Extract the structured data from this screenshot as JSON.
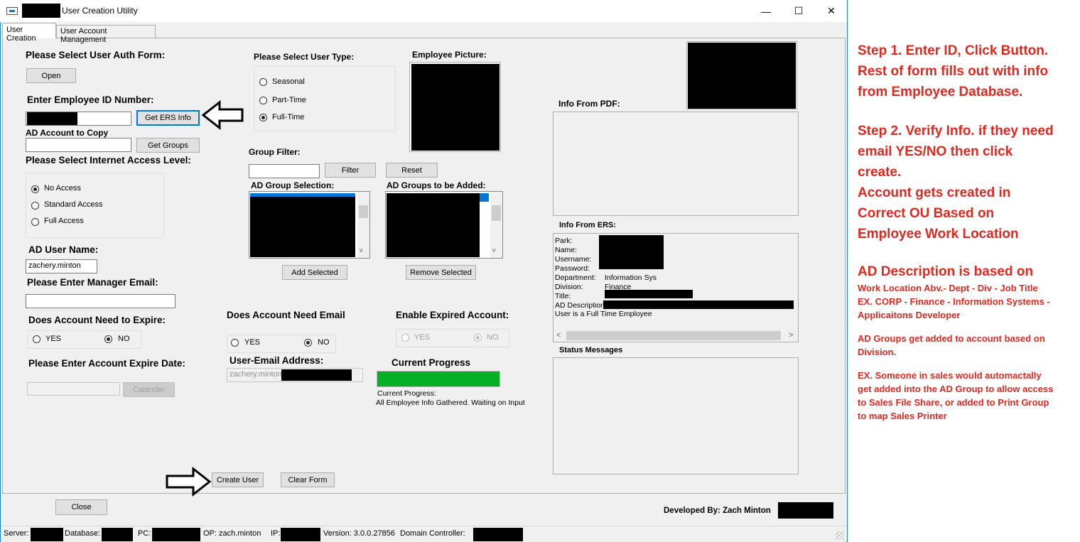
{
  "window": {
    "title": "User Creation Utility",
    "minimize": "—",
    "maximize": "☐",
    "close": "✕"
  },
  "tabs": [
    "User Creation",
    "User Account Management"
  ],
  "auth_form": {
    "label": "Please Select User Auth Form:",
    "open_button": "Open"
  },
  "employee_id": {
    "label": "Enter Employee ID Number:",
    "button": "Get ERS Info"
  },
  "ad_copy": {
    "label": "AD Account to Copy",
    "button": "Get Groups"
  },
  "internet_access": {
    "label": "Please Select Internet Access Level:",
    "options": [
      "No Access",
      "Standard Access",
      "Full Access"
    ],
    "selected": "No Access"
  },
  "ad_user_name": {
    "label": "AD User Name:",
    "value": "zachery.minton"
  },
  "manager_email": {
    "label": "Please Enter Manager Email:",
    "value": ""
  },
  "expire": {
    "label": "Does Account Need to Expire:",
    "yes": "YES",
    "no": "NO",
    "selected": "NO"
  },
  "expire_date": {
    "label": "Please Enter Account Expire Date:",
    "button": "Calander"
  },
  "user_type": {
    "label": "Please Select User Type:",
    "options": [
      "Seasonal",
      "Part-Time",
      "Full-Time"
    ],
    "selected": "Full-Time"
  },
  "group_filter": {
    "label": "Group Filter:",
    "filter_button": "Filter",
    "reset_button": "Reset"
  },
  "ad_group_selection": {
    "label": "AD Group Selection:",
    "button": "Add Selected"
  },
  "ad_groups_added": {
    "label": "AD Groups to be Added:",
    "button": "Remove Selected"
  },
  "employee_picture": {
    "label": "Employee Picture:"
  },
  "need_email": {
    "label": "Does Account Need Email",
    "yes": "YES",
    "no": "NO",
    "selected": "NO"
  },
  "user_email": {
    "label": "User-Email Address:",
    "value": "zachery.minton@"
  },
  "enable_expired": {
    "label": "Enable Expired Account:",
    "yes": "YES",
    "no": "NO",
    "selected": "NO"
  },
  "progress": {
    "label": "Current Progress",
    "value": 1.0,
    "color": "#06b025",
    "status_label": "Current Progress:",
    "status_text": "All Employee Info Gathered. Waiting on Input"
  },
  "info_pdf": {
    "label": "Info From PDF:"
  },
  "info_ers": {
    "label": "Info From ERS:",
    "rows": [
      {
        "key": "Park:",
        "value": ""
      },
      {
        "key": "Name:",
        "value": ""
      },
      {
        "key": "Username:",
        "value": ""
      },
      {
        "key": "Password:",
        "value": ""
      },
      {
        "key": "Department:",
        "value": "Information Sys"
      },
      {
        "key": "Division:",
        "value": "Finance"
      },
      {
        "key": "Title:",
        "value": ""
      },
      {
        "key": "AD Description:",
        "value": ""
      }
    ],
    "footer": "User is a Full Time Employee",
    "scroll_left": "<",
    "scroll_right": ">"
  },
  "status_messages": {
    "label": "Status Messages"
  },
  "actions": {
    "create": "Create User",
    "clear": "Clear Form",
    "close": "Close"
  },
  "developer": "Developed By: Zach Minton",
  "statusbar": {
    "server": "Server:",
    "database": "Database:",
    "pc": "PC:",
    "op": "OP: zach.minton",
    "ip": "IP:",
    "version": "Version: 3.0.0.27856",
    "dc": "Domain Controller:"
  },
  "annotations": {
    "step1": [
      "Step 1. Enter ID, Click Button.",
      "Rest of form fills out with info",
      "from Employee Database."
    ],
    "step2": [
      "Step 2. Verify Info. if they need",
      "email YES/NO then click",
      "create.",
      "Account gets created in",
      "Correct OU Based on",
      "Employee Work Location"
    ],
    "ad_desc_title": "AD Description is based on",
    "ad_desc_lines": [
      "Work Location Abv.- Dept - Div - Job Title",
      "EX. CORP - Finance - Information Systems -",
      "Applicaitons Developer"
    ],
    "groups_lines": [
      "AD Groups get added to account based on",
      "Division."
    ],
    "example_lines": [
      "EX. Someone in sales would automactally",
      "get added into the AD Group to allow access",
      "to Sales File Share, or added to Print Group",
      "to map Sales Printer"
    ],
    "accent_color": "#e0281f"
  }
}
